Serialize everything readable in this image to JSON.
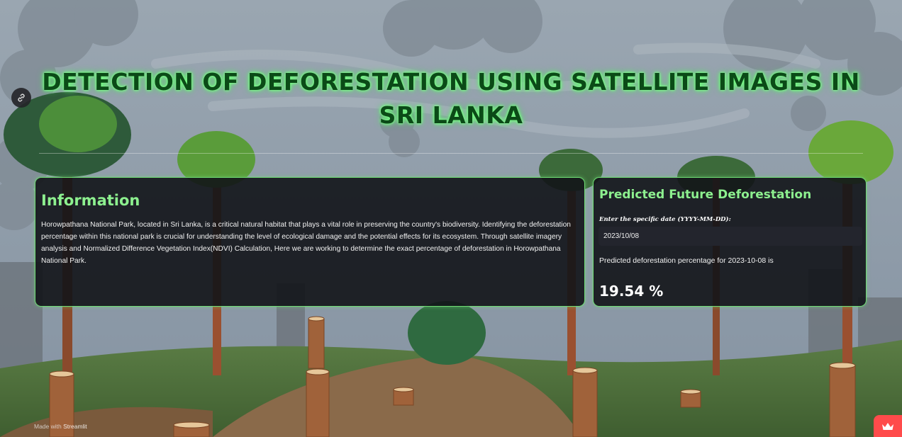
{
  "header": {
    "title": "DETECTION OF DEFORESTATION USING SATELLITE IMAGES IN SRI LANKA",
    "anchor_icon": "link-icon"
  },
  "info_card": {
    "title": "Information",
    "text": "Horowpathana National Park, located in Sri Lanka, is a critical natural habitat that plays a vital role in preserving the country's biodiversity. Identifying the deforestation percentage within this national park is crucial for understanding the level of ecological damage and the potential effects for its ecosystem. Through satellite imagery analysis and Normalized Difference Vegetation Index(NDVI) Calculation, Here we are working to determine the exact percentage of deforestation in Horowpathana National Park."
  },
  "prediction_card": {
    "title": "Predicted Future Deforestation",
    "date_label": "Enter the specific date (YYYY-MM-DD):",
    "date_value": "2023/10/08",
    "result_text": "Predicted deforestation percentage for 2023-10-08 is",
    "result_value": "19.54 %"
  },
  "footer": {
    "made_with": "Made with",
    "brand": "Streamlit",
    "badge_icon": "crown-icon"
  },
  "colors": {
    "accent_green": "#8df08f",
    "card_border": "#6fdc74",
    "title_dark_green": "#0b4a17",
    "badge_red": "#ff4b4b"
  }
}
